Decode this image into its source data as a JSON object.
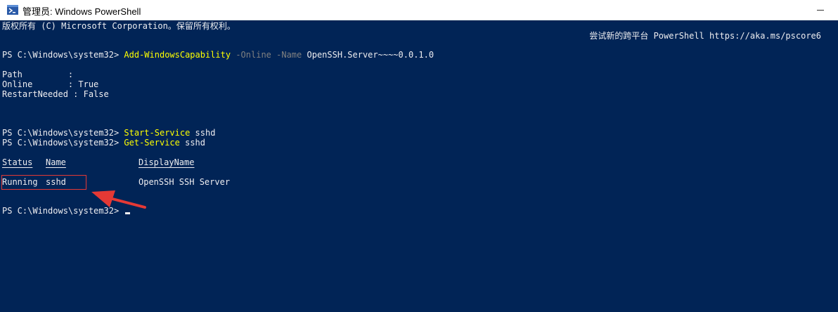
{
  "window": {
    "title": "管理员: Windows PowerShell",
    "icon": "powershell-icon"
  },
  "console": {
    "lines": [
      "版权所有 (C) Microsoft Corporation。保留所有权利。",
      "尝试新的跨平台 PowerShell https://aka.ms/pscore6",
      "PS C:\\Windows\\system32> ",
      "Add-WindowsCapability",
      " -Online",
      " -Name",
      " OpenSSH.Server~~~~0.0.1.0",
      "Path         :",
      "Online       : True",
      "RestartNeeded : False",
      "PS C:\\Windows\\system32> ",
      "Start-Service",
      " sshd",
      "PS C:\\Windows\\system32> ",
      "Get-Service",
      " sshd",
      "Status",
      "Name",
      "DisplayName",
      "Running",
      "sshd",
      "OpenSSH SSH Server",
      "PS C:\\Windows\\system32> "
    ]
  },
  "colors": {
    "background": "#012456",
    "text": "#eeedf0",
    "command": "#ffff00",
    "parameter": "#808080",
    "annotation": "#e53935"
  }
}
